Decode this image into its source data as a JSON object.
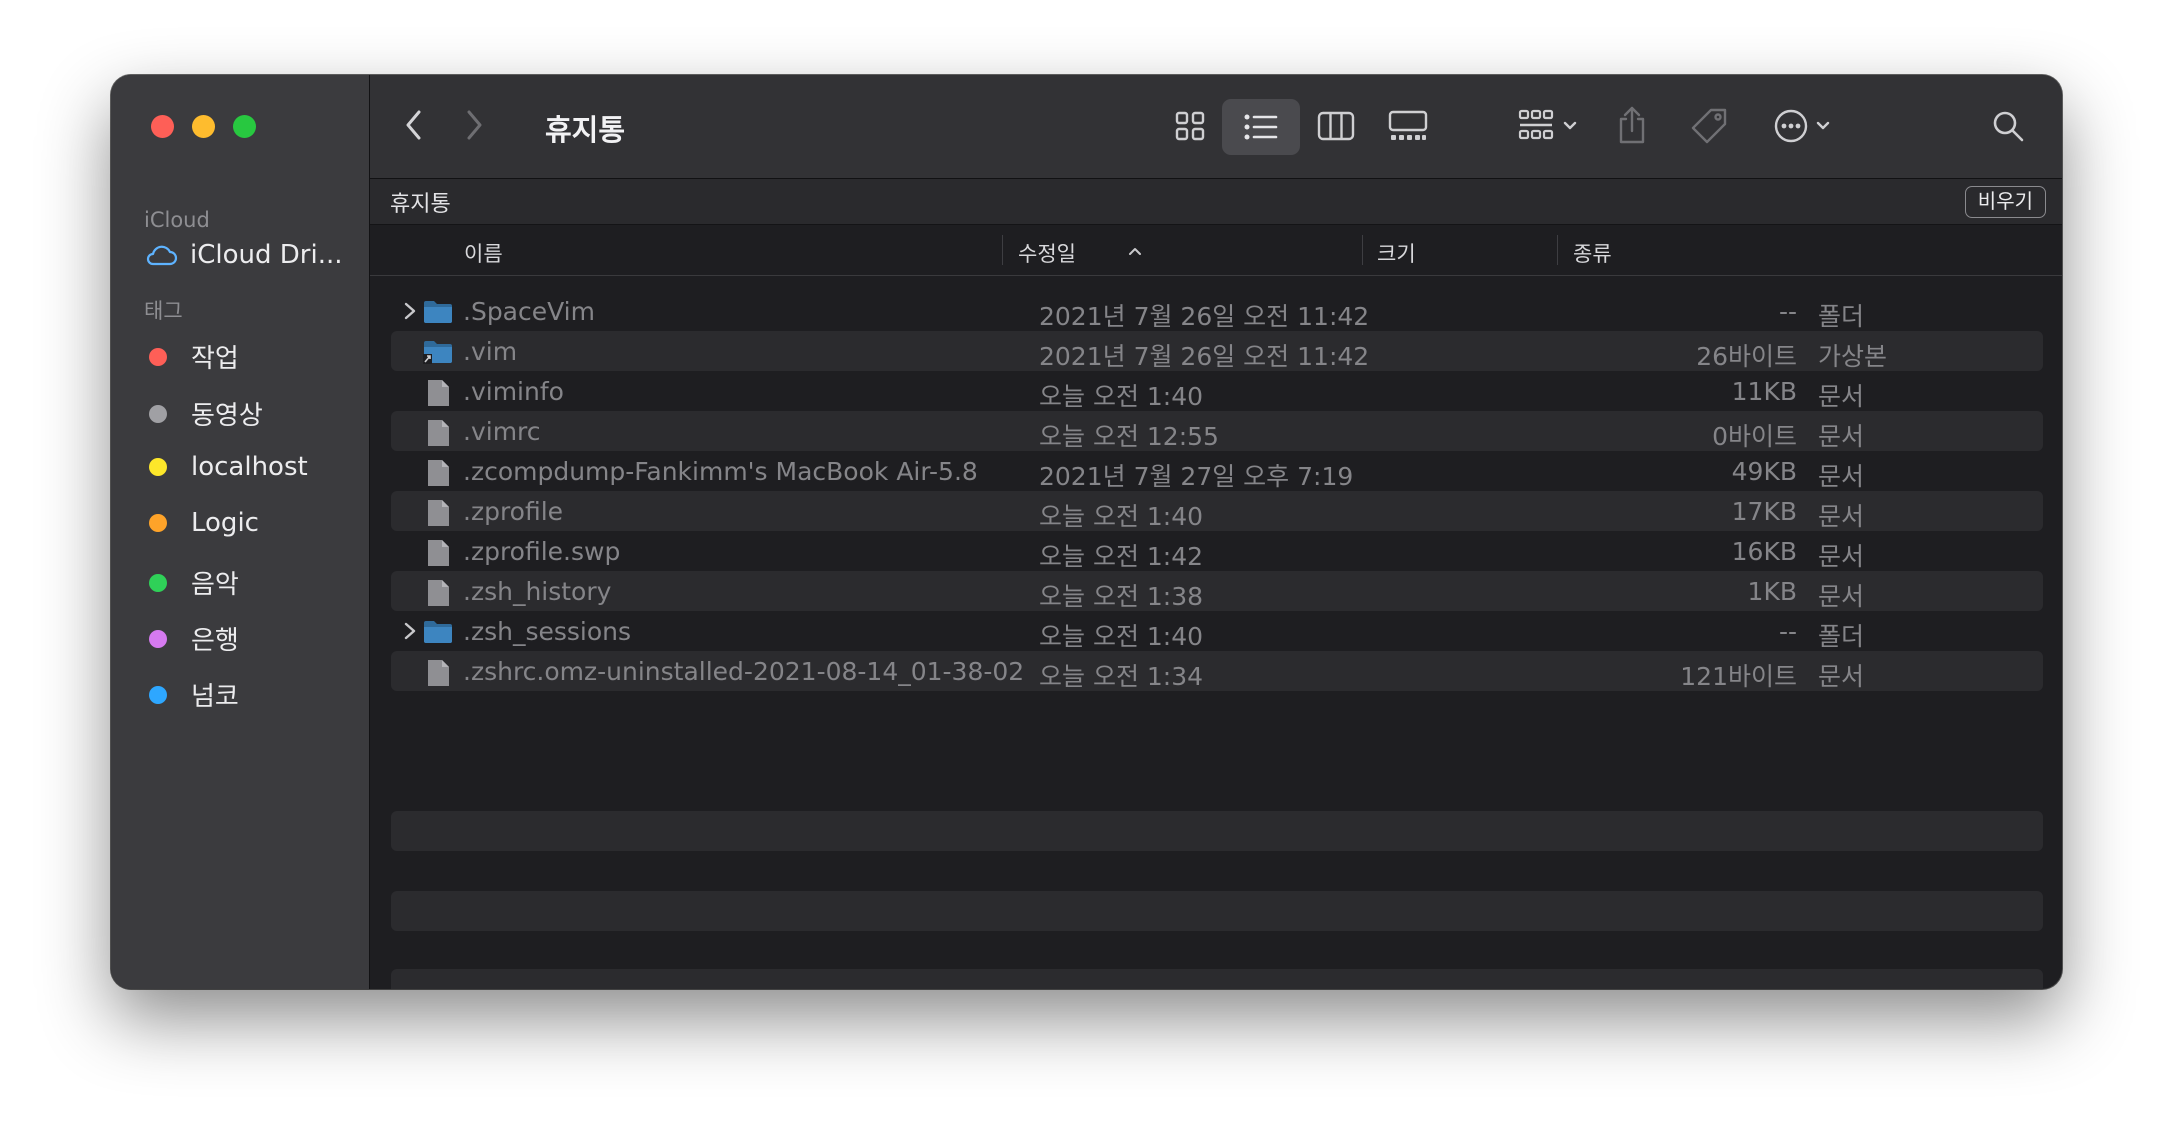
{
  "window": {
    "title": "휴지통"
  },
  "sidebar": {
    "icloud_section": "iCloud",
    "icloud_drive": "iCloud Dri...",
    "tags_section": "태그",
    "tags": [
      {
        "label": "작업",
        "color": "#fe5f57"
      },
      {
        "label": "동영상",
        "color": "#a0a0a4"
      },
      {
        "label": "localhost",
        "color": "#fde72a"
      },
      {
        "label": "Logic",
        "color": "#fea329"
      },
      {
        "label": "음악",
        "color": "#2fd158"
      },
      {
        "label": "은행",
        "color": "#d67af0"
      },
      {
        "label": "넘코",
        "color": "#2ea7ff"
      }
    ]
  },
  "pathbar": {
    "title": "휴지통",
    "empty_label": "비우기"
  },
  "columns": {
    "name": "이름",
    "date": "수정일",
    "size": "크기",
    "kind": "종류"
  },
  "files": [
    {
      "name": ".SpaceVim",
      "date": "2021년 7월 26일 오전 11:42",
      "size": "--",
      "kind": "폴더",
      "icon": "folder-icon",
      "expandable": true
    },
    {
      "name": ".vim",
      "date": "2021년 7월 26일 오전 11:42",
      "size": "26바이트",
      "kind": "가상본",
      "icon": "alias-folder-icon",
      "expandable": false
    },
    {
      "name": ".viminfo",
      "date": "오늘 오전 1:40",
      "size": "11KB",
      "kind": "문서",
      "icon": "document-icon",
      "expandable": false
    },
    {
      "name": ".vimrc",
      "date": "오늘 오전 12:55",
      "size": "0바이트",
      "kind": "문서",
      "icon": "document-icon",
      "expandable": false
    },
    {
      "name": ".zcompdump-Fankimm's MacBook Air-5.8",
      "date": "2021년 7월 27일 오후 7:19",
      "size": "49KB",
      "kind": "문서",
      "icon": "document-icon",
      "expandable": false
    },
    {
      "name": ".zprofile",
      "date": "오늘 오전 1:40",
      "size": "17KB",
      "kind": "문서",
      "icon": "document-icon",
      "expandable": false
    },
    {
      "name": ".zprofile.swp",
      "date": "오늘 오전 1:42",
      "size": "16KB",
      "kind": "문서",
      "icon": "document-icon",
      "expandable": false
    },
    {
      "name": ".zsh_history",
      "date": "오늘 오전 1:38",
      "size": "1KB",
      "kind": "문서",
      "icon": "document-icon",
      "expandable": false
    },
    {
      "name": ".zsh_sessions",
      "date": "오늘 오전 1:40",
      "size": "--",
      "kind": "폴더",
      "icon": "folder-icon",
      "expandable": true
    },
    {
      "name": ".zshrc.omz-uninstalled-2021-08-14_01-38-02",
      "date": "오늘 오전 1:34",
      "size": "121바이트",
      "kind": "문서",
      "icon": "document-icon",
      "expandable": false
    }
  ]
}
